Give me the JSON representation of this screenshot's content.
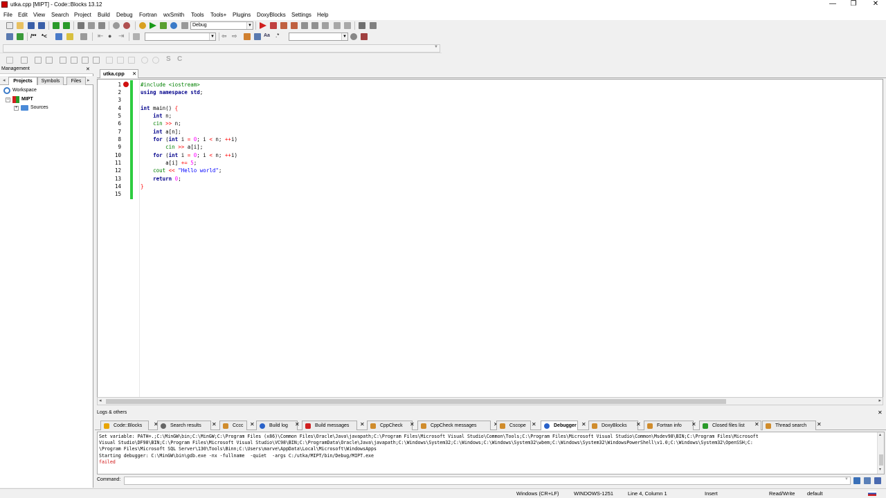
{
  "window": {
    "title": "utka.cpp [MIPT] - Code::Blocks 13.12",
    "minimize": "—",
    "maximize": "❐",
    "close": "✕"
  },
  "menu": [
    "File",
    "Edit",
    "View",
    "Search",
    "Project",
    "Build",
    "Debug",
    "Fortran",
    "wxSmith",
    "Tools",
    "Tools+",
    "Plugins",
    "DoxyBlocks",
    "Settings",
    "Help"
  ],
  "toolbar": {
    "build_target": "Debug",
    "find_combo": "",
    "symbol_combo": ""
  },
  "management": {
    "title": "Management",
    "close": "✕",
    "tabs": [
      "Projects",
      "Symbols",
      "Files"
    ],
    "active_tab": "Projects",
    "tree": {
      "workspace": "Workspace",
      "project": "MIPT",
      "folder": "Sources"
    }
  },
  "editor": {
    "tab_label": "utka.cpp",
    "tab_close": "✕",
    "line_numbers": [
      "1",
      "2",
      "3",
      "4",
      "5",
      "6",
      "7",
      "8",
      "9",
      "10",
      "11",
      "12",
      "13",
      "14",
      "15"
    ],
    "breakpoint_line": 1
  },
  "logs": {
    "title": "Logs & others",
    "close": "✕",
    "tabs": [
      {
        "label": "Code::Blocks",
        "icon": "code-blocks-icon",
        "color": "#e8a400"
      },
      {
        "label": "Search results",
        "icon": "search-icon",
        "color": "#666666"
      },
      {
        "label": "Cccc",
        "icon": "cccc-icon",
        "color": "#d08c2c"
      },
      {
        "label": "Build log",
        "icon": "build-log-icon",
        "color": "#2a62c9"
      },
      {
        "label": "Build messages",
        "icon": "build-messages-icon",
        "color": "#d02020"
      },
      {
        "label": "CppCheck",
        "icon": "cppcheck-icon",
        "color": "#d08c2c"
      },
      {
        "label": "CppCheck messages",
        "icon": "cppcheck-messages-icon",
        "color": "#d08c2c"
      },
      {
        "label": "Cscope",
        "icon": "cscope-icon",
        "color": "#d08c2c"
      },
      {
        "label": "Debugger",
        "icon": "debugger-icon",
        "color": "#2a62c9"
      },
      {
        "label": "DoxyBlocks",
        "icon": "doxyblocks-icon",
        "color": "#d08c2c"
      },
      {
        "label": "Fortran info",
        "icon": "fortran-info-icon",
        "color": "#d08c2c"
      },
      {
        "label": "Closed files list",
        "icon": "closed-files-icon",
        "color": "#2a9a2a"
      },
      {
        "label": "Thread search",
        "icon": "thread-search-icon",
        "color": "#d08c2c"
      }
    ],
    "active_tab": "Debugger",
    "lines": [
      "Set variable: PATH=.;C:\\MinGW\\bin;C:\\MinGW;C:\\Program Files (x86)\\Common Files\\Oracle\\Java\\javapath;C:\\Program Files\\Microsoft Visual Studio\\Common\\Tools;C:\\Program Files\\Microsoft Visual Studio\\Common\\Msdev98\\BIN;C:\\Program Files\\Microsoft",
      "Visual Studio\\DF98\\BIN;C:\\Program Files\\Microsoft Visual Studio\\VC98\\BIN;C:\\ProgramData\\Oracle\\Java\\javapath;C:\\Windows\\System32;C:\\Windows;C:\\Windows\\System32\\wbem;C:\\Windows\\System32\\WindowsPowerShell\\v1.0;C:\\Windows\\System32\\OpenSSH;C:",
      "\\Program Files\\Microsoft SQL Server\\130\\Tools\\Binn;C:\\Users\\marve\\AppData\\Local\\Microsoft\\WindowsApps",
      "Starting debugger: C:\\MinGW\\bin\\gdb.exe -nx -fullname  -quiet  -args C:/utka/MIPT/bin/Debug/MIPT.exe",
      "failed"
    ],
    "command_label": "Command:"
  },
  "status": {
    "eol": "Windows (CR+LF)",
    "encoding": "WINDOWS-1251",
    "position": "Line 4, Column 1",
    "mode": "Insert",
    "access": "Read/Write",
    "lang": "default"
  }
}
